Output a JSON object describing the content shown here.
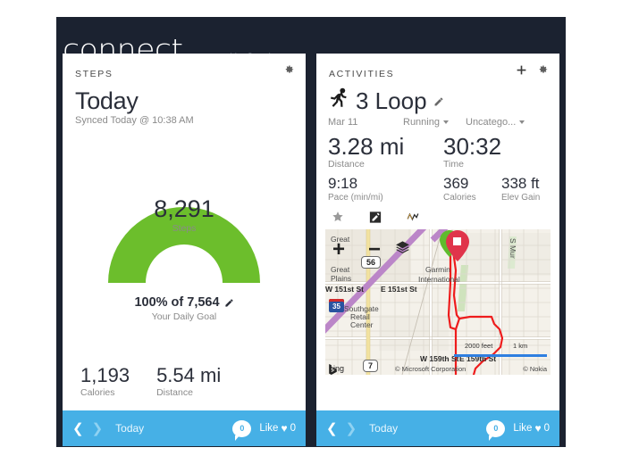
{
  "header": {
    "brand": "connect",
    "tagline": "powered by Garmin"
  },
  "steps_card": {
    "section_title": "STEPS",
    "gear_icon": "gear-icon",
    "title": "Today",
    "synced": "Synced Today @ 10:38 AM",
    "gauge": {
      "value": "8,291",
      "label": "Steps",
      "percent_text": "100% of 7,564",
      "goal_label": "Your Daily Goal",
      "edit_icon": "pencil-icon",
      "color": "#6cbe2c",
      "percent": 100
    },
    "stats": [
      {
        "value": "1,193",
        "label": "Calories"
      },
      {
        "value": "5.54 mi",
        "label": "Distance"
      }
    ],
    "footer": {
      "prev_icon": "chevron-left-icon",
      "next_icon": "chevron-right-icon",
      "label": "Today",
      "comment_count": "0",
      "like_label": "Like",
      "heart_icon": "heart-icon",
      "like_count": "0"
    }
  },
  "activities_card": {
    "section_title": "ACTIVITIES",
    "add_icon": "plus-icon",
    "gear_icon": "gear-icon",
    "activity_icon": "runner-icon",
    "activity_name": "3 Loop",
    "edit_icon": "pencil-icon",
    "date": "Mar 11",
    "type_select": "Running",
    "category_select": "Uncatego...",
    "big_stats": [
      {
        "value": "3.28 mi",
        "label": "Distance"
      },
      {
        "value": "30:32",
        "label": "Time"
      }
    ],
    "mid_stats": [
      {
        "value": "9:18",
        "label": "Pace (min/mi)"
      },
      {
        "value": "369",
        "label": "Calories"
      },
      {
        "value": "338 ft",
        "label": "Elev Gain"
      }
    ],
    "action_icons": [
      {
        "name": "star-icon"
      },
      {
        "name": "note-edit-icon"
      },
      {
        "name": "chart-line-icon"
      }
    ],
    "map": {
      "zoom_in": "+",
      "zoom_out": "−",
      "layers_icon": "layers-icon",
      "labels": [
        "Great",
        "Great",
        "Plains",
        "W 151st St",
        "E 151st St",
        "Southgate",
        "Retail",
        "Center",
        "Garmin",
        "International",
        "S Mur",
        "W 159th St",
        "E 159th St"
      ],
      "shields": [
        "56",
        "7",
        "35"
      ],
      "scale_feet": "2000 feet",
      "scale_km": "1 km",
      "provider": "bing",
      "attrib_left": "© Microsoft Corporation",
      "attrib_right": "© Nokia",
      "track_color": "#ee1c1c",
      "start_pin_color": "#5fbb2d",
      "end_pin_color": "#e0344b"
    },
    "footer": {
      "prev_icon": "chevron-left-icon",
      "next_icon": "chevron-right-icon",
      "label": "Today",
      "comment_count": "0",
      "like_label": "Like",
      "heart_icon": "heart-icon",
      "like_count": "0"
    }
  }
}
